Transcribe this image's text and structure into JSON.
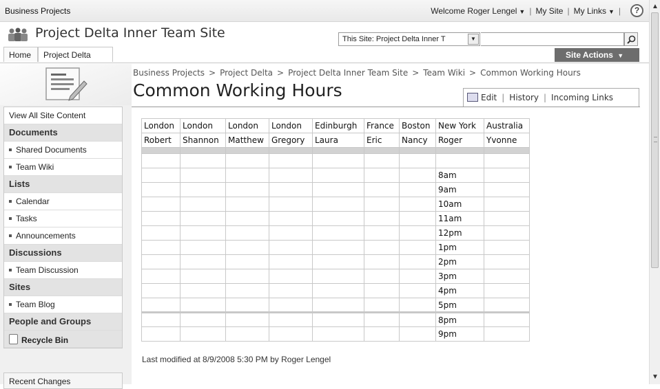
{
  "topbar": {
    "site_name": "Business Projects",
    "welcome": "Welcome Roger Lengel",
    "my_site": "My Site",
    "my_links": "My Links"
  },
  "header": {
    "site_title": "Project Delta Inner Team Site",
    "search_scope": "This Site: Project Delta Inner T",
    "search_value": ""
  },
  "nav": {
    "tabs": [
      "Home",
      "Project Delta"
    ],
    "site_actions": "Site Actions"
  },
  "sidebar": {
    "view_all": "View All Site Content",
    "sections": [
      {
        "heading": "Documents",
        "items": [
          "Shared Documents",
          "Team Wiki"
        ]
      },
      {
        "heading": "Lists",
        "items": [
          "Calendar",
          "Tasks",
          "Announcements"
        ]
      },
      {
        "heading": "Discussions",
        "items": [
          "Team Discussion"
        ]
      },
      {
        "heading": "Sites",
        "items": [
          "Team Blog"
        ]
      }
    ],
    "people_groups": "People and Groups",
    "recycle_bin": "Recycle Bin",
    "recent_changes": "Recent Changes"
  },
  "breadcrumb": [
    "Business Projects",
    "Project Delta",
    "Project Delta Inner Team Site",
    "Team Wiki",
    "Common Working Hours"
  ],
  "breadcrumb_separator": ">",
  "page": {
    "title": "Common Working Hours",
    "actions": [
      "Edit",
      "History",
      "Incoming Links"
    ],
    "last_modified": "Last modified at 8/9/2008 5:30 PM  by Roger Lengel"
  },
  "table": {
    "locations": [
      "London",
      "London",
      "London",
      "London",
      "Edinburgh",
      "France",
      "Boston",
      "New York",
      "Australia"
    ],
    "people": [
      "Robert",
      "Shannon",
      "Matthew",
      "Gregory",
      "Laura",
      "Eric",
      "Nancy",
      "Roger",
      "Yvonne"
    ],
    "hours_block1": [
      "",
      "8am",
      "9am",
      "10am",
      "11am",
      "12pm",
      "1pm",
      "2pm",
      "3pm",
      "4pm",
      "5pm"
    ],
    "hours_block2": [
      "8pm",
      "9pm"
    ]
  }
}
